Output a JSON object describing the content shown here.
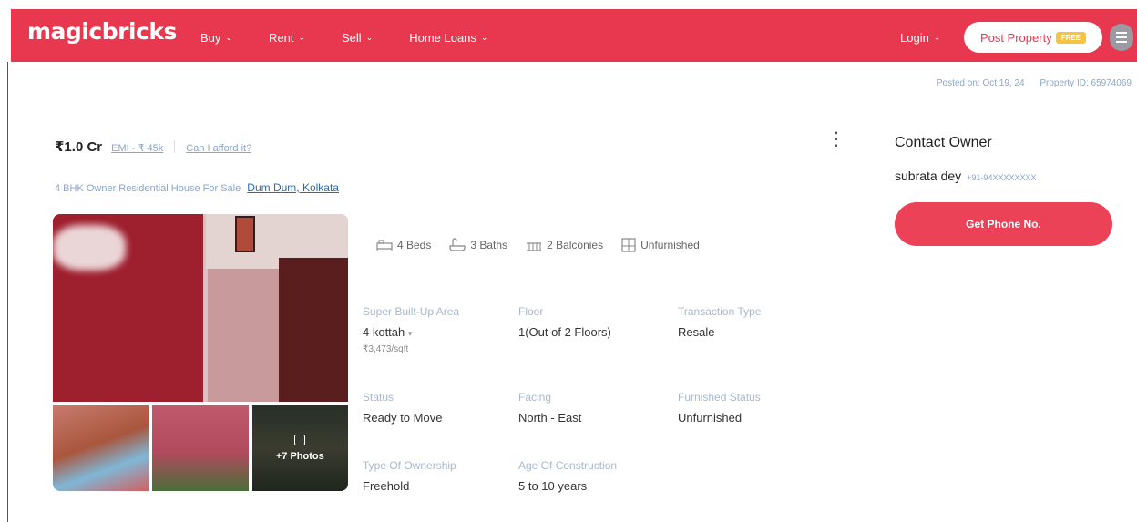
{
  "header": {
    "logo": "magicbricks",
    "nav": [
      {
        "label": "Buy"
      },
      {
        "label": "Rent"
      },
      {
        "label": "Sell"
      },
      {
        "label": "Home Loans"
      }
    ],
    "login_label": "Login",
    "post_property_label": "Post Property",
    "post_property_badge": "FREE",
    "colors": {
      "brand": "#e8384f"
    }
  },
  "meta": {
    "posted_on": "Posted on: Oct 19, 24",
    "property_id": "Property ID: 65974069"
  },
  "listing": {
    "price": "₹1.0 Cr",
    "emi": "EMI - ₹ 45k",
    "afford_link": "Can I afford it?",
    "subtitle": "4 BHK Owner Residential House For Sale",
    "location_link": "Dum Dum, Kolkata",
    "photos_more": "+7 Photos"
  },
  "amenities": [
    {
      "icon": "bed-icon",
      "label": "4 Beds"
    },
    {
      "icon": "bath-icon",
      "label": "3 Baths"
    },
    {
      "icon": "balcony-icon",
      "label": "2 Balconies"
    },
    {
      "icon": "furnishing-icon",
      "label": "Unfurnished"
    }
  ],
  "specs": {
    "area": {
      "label": "Super Built-Up Area",
      "value": "4 kottah",
      "sub": "₹3,473/sqft"
    },
    "floor": {
      "label": "Floor",
      "value": "1(Out of 2 Floors)"
    },
    "transaction": {
      "label": "Transaction Type",
      "value": "Resale"
    },
    "status": {
      "label": "Status",
      "value": "Ready to Move"
    },
    "facing": {
      "label": "Facing",
      "value": "North - East"
    },
    "furnished": {
      "label": "Furnished Status",
      "value": "Unfurnished"
    },
    "ownership": {
      "label": "Type Of Ownership",
      "value": "Freehold"
    },
    "age": {
      "label": "Age Of Construction",
      "value": "5 to 10 years"
    }
  },
  "contact": {
    "title": "Contact Owner",
    "owner_name": "subrata dey",
    "owner_phone": "+91-94XXXXXXXX",
    "button_label": "Get Phone No."
  }
}
